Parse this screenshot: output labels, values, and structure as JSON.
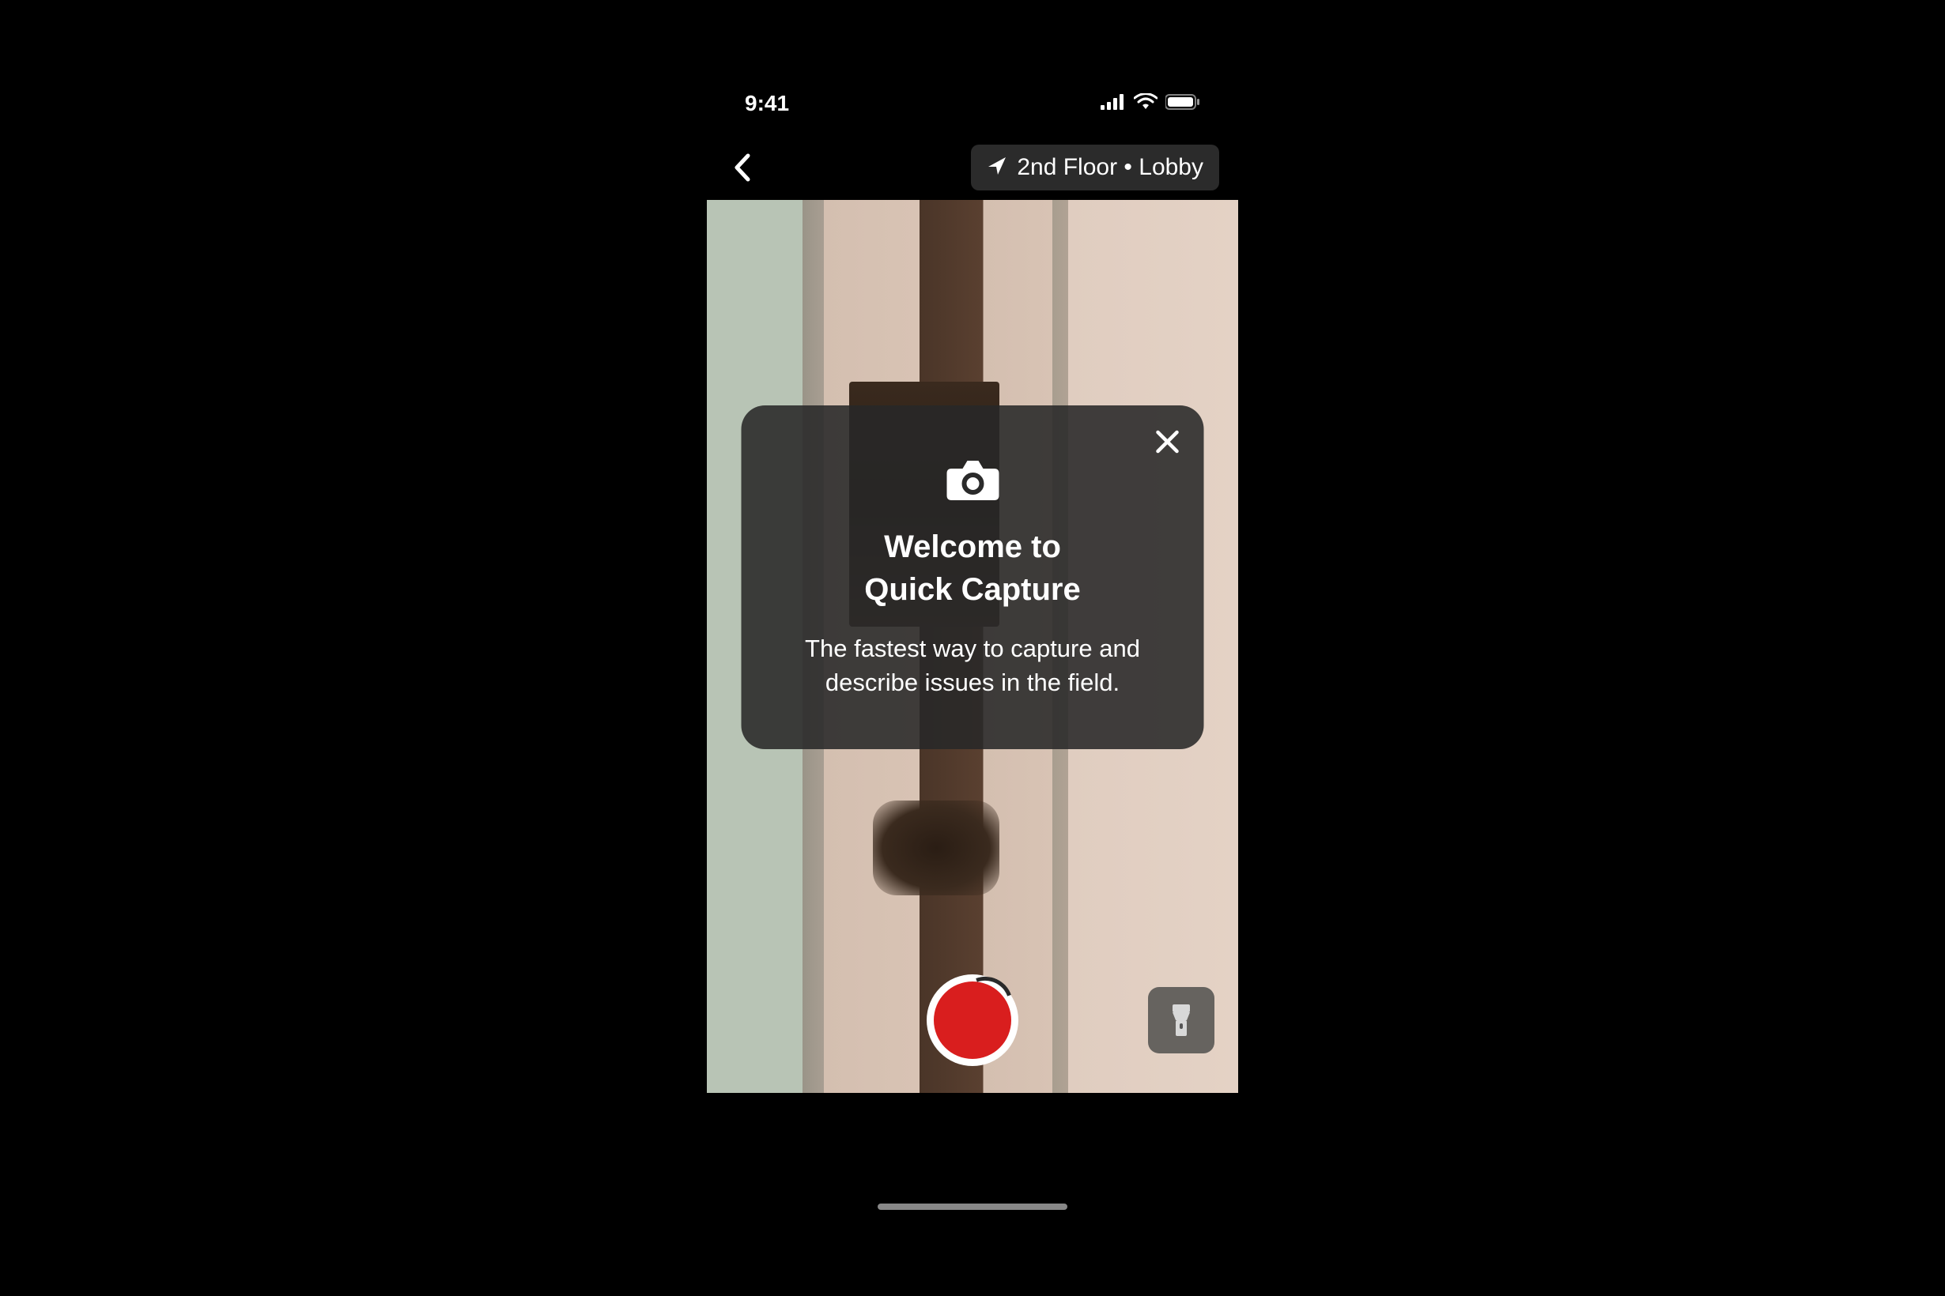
{
  "status_bar": {
    "time": "9:41"
  },
  "nav": {
    "location": "2nd Floor • Lobby"
  },
  "overlay": {
    "title_line1": "Welcome to",
    "title_line2": "Quick Capture",
    "description": "The fastest way to capture and describe issues in the field."
  },
  "colors": {
    "shutter_red": "#d91e1e",
    "overlay_bg": "rgba(40, 40, 40, 0.88)"
  }
}
